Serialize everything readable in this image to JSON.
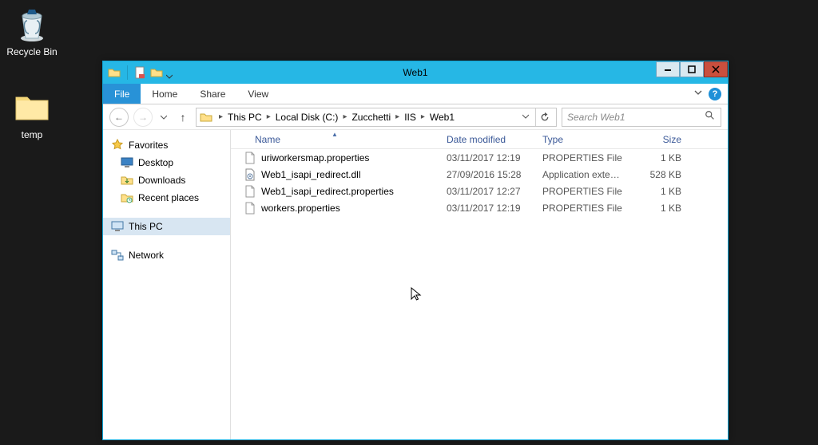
{
  "desktop": {
    "recycle_bin": "Recycle Bin",
    "temp": "temp"
  },
  "window": {
    "title": "Web1",
    "controls": {
      "min": "—",
      "max": "❐",
      "close": "✕"
    }
  },
  "ribbon": {
    "file": "File",
    "tabs": [
      "Home",
      "Share",
      "View"
    ]
  },
  "address": {
    "crumbs": [
      "This PC",
      "Local Disk (C:)",
      "Zucchetti",
      "IIS",
      "Web1"
    ]
  },
  "search": {
    "placeholder": "Search Web1"
  },
  "nav": {
    "favorites": {
      "label": "Favorites",
      "items": [
        "Desktop",
        "Downloads",
        "Recent places"
      ]
    },
    "this_pc": "This PC",
    "network": "Network"
  },
  "columns": {
    "name": "Name",
    "date": "Date modified",
    "type": "Type",
    "size": "Size"
  },
  "files": [
    {
      "name": "uriworkersmap.properties",
      "date": "03/11/2017 12:19",
      "type": "PROPERTIES File",
      "size": "1 KB",
      "kind": "doc"
    },
    {
      "name": "Web1_isapi_redirect.dll",
      "date": "27/09/2016 15:28",
      "type": "Application extens...",
      "size": "528 KB",
      "kind": "dll"
    },
    {
      "name": "Web1_isapi_redirect.properties",
      "date": "03/11/2017 12:27",
      "type": "PROPERTIES File",
      "size": "1 KB",
      "kind": "doc"
    },
    {
      "name": "workers.properties",
      "date": "03/11/2017 12:19",
      "type": "PROPERTIES File",
      "size": "1 KB",
      "kind": "doc"
    }
  ]
}
